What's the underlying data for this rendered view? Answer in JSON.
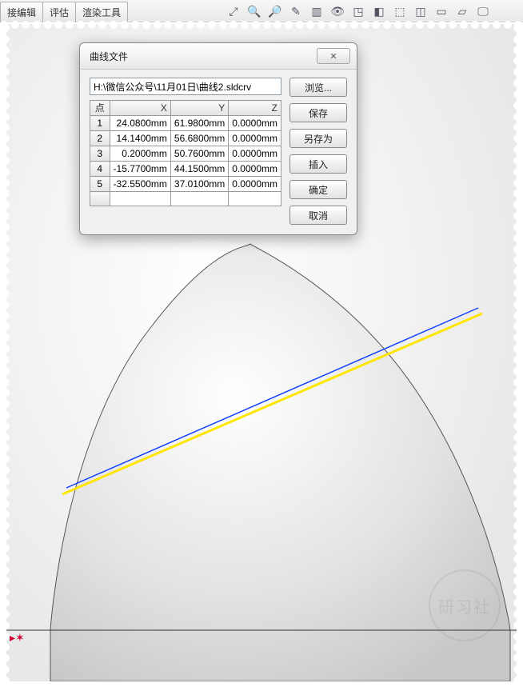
{
  "tabs": {
    "edit": "接编辑",
    "eval": "评估",
    "render": "渲染工具"
  },
  "dialog": {
    "title": "曲线文件",
    "path": "H:\\微信公众号\\11月01日\\曲线2.sldcrv",
    "headers": {
      "pt": "点",
      "x": "X",
      "y": "Y",
      "z": "Z"
    },
    "rows": [
      {
        "i": "1",
        "x": "24.0800mm",
        "y": "61.9800mm",
        "z": "0.0000mm"
      },
      {
        "i": "2",
        "x": "14.1400mm",
        "y": "56.6800mm",
        "z": "0.0000mm"
      },
      {
        "i": "3",
        "x": "0.2000mm",
        "y": "50.7600mm",
        "z": "0.0000mm"
      },
      {
        "i": "4",
        "x": "-15.7700mm",
        "y": "44.1500mm",
        "z": "0.0000mm"
      },
      {
        "i": "5",
        "x": "-32.5500mm",
        "y": "37.0100mm",
        "z": "0.0000mm"
      }
    ],
    "buttons": {
      "browse": "浏览...",
      "save": "保存",
      "saveas": "另存为",
      "insert": "插入",
      "ok": "确定",
      "cancel": "取消"
    },
    "close_glyph": "✕"
  },
  "watermark": "研习社",
  "chart_data": {
    "type": "table",
    "title": "曲线文件",
    "columns": [
      "点",
      "X",
      "Y",
      "Z"
    ],
    "rows": [
      [
        1,
        24.08,
        61.98,
        0.0
      ],
      [
        2,
        14.14,
        56.68,
        0.0
      ],
      [
        3,
        0.2,
        50.76,
        0.0
      ],
      [
        4,
        -15.77,
        44.15,
        0.0
      ],
      [
        5,
        -32.55,
        37.01,
        0.0
      ]
    ],
    "unit": "mm"
  }
}
